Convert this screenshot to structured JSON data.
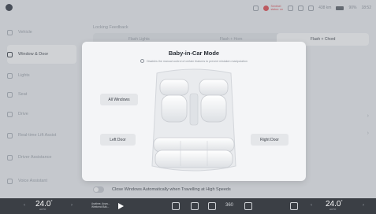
{
  "status": {
    "sentry_line1": "Sentinel",
    "sentry_line2": "status: on",
    "range": "438 km",
    "battery": "90%",
    "clock": "18:52"
  },
  "sidebar": {
    "items": [
      {
        "label": "Vehicle"
      },
      {
        "label": "Window & Door"
      },
      {
        "label": "Lights"
      },
      {
        "label": "Seat"
      },
      {
        "label": "Drive"
      },
      {
        "label": "Real-time Lift Assist"
      },
      {
        "label": "Driver Assistance"
      },
      {
        "label": "Voice Assistant"
      }
    ]
  },
  "content": {
    "section_label": "Locking Feedback",
    "segments": [
      "Flash Lights",
      "Flash + Horn",
      "Flash + Chord"
    ],
    "toggle_label": "Close Windows Automatically when Travelling at High Speeds"
  },
  "modal": {
    "title": "Baby-in-Car Mode",
    "subtitle": "Disables the manual control of certain features to prevent mistaken manipulation",
    "all_windows": "All Windows",
    "left_door": "Left Door",
    "right_door": "Right Door"
  },
  "bottombar": {
    "left_temp": "24.0",
    "right_temp": "24.0",
    "deg": "°",
    "auto": "AUTO",
    "media_line1": "Anytime, Anyw...",
    "media_line2": "Weekend Bak...",
    "cam_label": "360"
  },
  "colors": {
    "accent_red": "#e0454b",
    "bar_bg": "#3b3f45",
    "modal_bg": "#f4f5f7"
  }
}
